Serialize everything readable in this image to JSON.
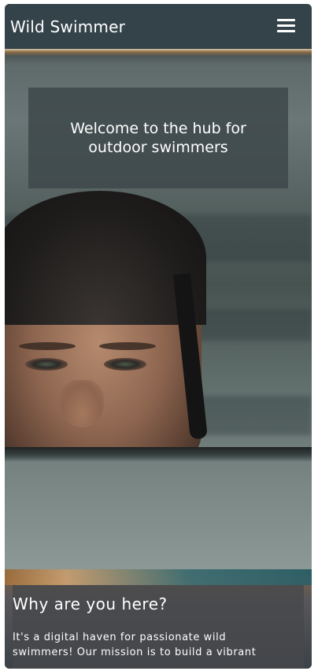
{
  "navbar": {
    "brand": "Wild Swimmer",
    "menu_icon": "hamburger-menu-icon"
  },
  "hero": {
    "welcome_text": "Welcome to the hub for outdoor swimmers",
    "image_subject": "swimmer-in-water"
  },
  "about": {
    "heading": "Why are you here?",
    "body": "It's a digital haven for passionate wild swimmers! Our mission is to build a vibrant"
  },
  "colors": {
    "navbar": "#34434a",
    "text": "#ffffff",
    "overlay": "#3e484b"
  }
}
